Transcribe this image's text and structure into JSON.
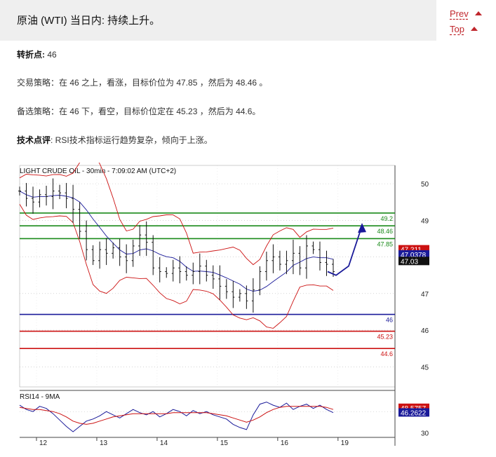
{
  "header": {
    "title": "原油 (WTI) 当日内: 持续上升。"
  },
  "nav": {
    "prev": "Prev",
    "top": "Top"
  },
  "analysis": {
    "pivot_label": "转折点:",
    "pivot_value": "46",
    "strategy_label": "交易策略：",
    "strategy_text": "在 46 之上，看涨，目标价位为 47.85 ，然后为 48.46 。",
    "alt_label": "备选策略：",
    "alt_text": "在 46 下，看空，目标价位定在 45.23 ，然后为 44.6。",
    "tech_label": "技术点评",
    "tech_text": ": RSI技术指标运行趋势复杂，倾向于上涨。"
  },
  "colors": {
    "resistance": "#1a8a1a",
    "pivot": "#1a1a99",
    "support": "#cc1111",
    "price": "#111111",
    "bollinger": "#cc1111",
    "moving_average": "#1a1a99"
  },
  "chart_data": [
    {
      "type": "line",
      "subtype": "candlestick",
      "title": "LIGHT CRUDE OIL - 30min - 7:09:02 AM (UTC+2)",
      "x_ticks": [
        "12",
        "13",
        "14",
        "15",
        "16",
        "19"
      ],
      "y_ticks": [
        50,
        49,
        48,
        47,
        46,
        45
      ],
      "ylim": [
        44.45,
        50.5
      ],
      "levels": [
        {
          "label": "49.2",
          "value": 49.2,
          "kind": "resistance"
        },
        {
          "label": "48.46",
          "value": 48.85,
          "kind": "resistance"
        },
        {
          "label": "47.85",
          "value": 48.5,
          "kind": "resistance"
        },
        {
          "label": "46",
          "value": 46.43,
          "kind": "pivot"
        },
        {
          "label": "45.23",
          "value": 45.97,
          "kind": "support"
        },
        {
          "label": "44.6",
          "value": 45.5,
          "kind": "support"
        }
      ],
      "markers": [
        {
          "label": "47.211",
          "value": 48.21,
          "color": "#cc1111"
        },
        {
          "label": "47.0378",
          "value": 48.07,
          "color": "#1a1a99"
        },
        {
          "label": "47.03",
          "value": 47.89,
          "color": "#111111"
        }
      ],
      "close_series": [
        49.8,
        49.6,
        49.5,
        49.7,
        49.65,
        49.8,
        49.75,
        49.6,
        49.3,
        48.7,
        48.2,
        47.9,
        48.2,
        48.1,
        48.25,
        48.0,
        47.9,
        48.3,
        48.6,
        48.4,
        47.7,
        47.6,
        47.55,
        47.7,
        47.6,
        47.5,
        47.6,
        47.75,
        47.5,
        47.4,
        47.2,
        47.05,
        46.9,
        47.0,
        46.8,
        47.1,
        47.6,
        47.9,
        48.0,
        47.8,
        47.9,
        48.1,
        47.7,
        48.3,
        48.2,
        47.85,
        47.8,
        47.6
      ],
      "forecast_path": [
        47.6,
        47.5,
        47.75,
        48.85
      ],
      "pivot_index_day19": 19
    },
    {
      "type": "line",
      "title": "RSI14 - 9MA",
      "y_ticks": [
        30
      ],
      "ylim": [
        27,
        68
      ],
      "series": [
        {
          "name": "RSI14",
          "values": [
            56,
            52,
            50,
            55,
            53,
            48,
            42,
            36,
            31,
            36,
            41,
            43,
            46,
            50,
            47,
            44,
            48,
            52,
            49,
            47,
            50,
            45,
            48,
            52,
            50,
            46,
            51,
            48,
            50,
            47,
            45,
            43,
            38,
            35,
            33,
            47,
            57,
            59,
            56,
            54,
            58,
            52,
            55,
            57,
            53,
            56,
            52,
            49
          ]
        },
        {
          "name": "9MA",
          "values": [
            54,
            53,
            52,
            52,
            51,
            50,
            48,
            45,
            41,
            39,
            38,
            39,
            41,
            43,
            45,
            46,
            47,
            48,
            48,
            48,
            48,
            48,
            48,
            49,
            49,
            49,
            49,
            49,
            49,
            48,
            47,
            46,
            44,
            42,
            40,
            42,
            45,
            49,
            52,
            54,
            55,
            55,
            55,
            55,
            55,
            55,
            54,
            52
          ]
        }
      ],
      "markers": [
        {
          "label": "48.5757",
          "value": 53.6,
          "color": "#cc1111"
        },
        {
          "label": "46.2622",
          "value": 49.2,
          "color": "#1a1a99"
        }
      ]
    }
  ]
}
